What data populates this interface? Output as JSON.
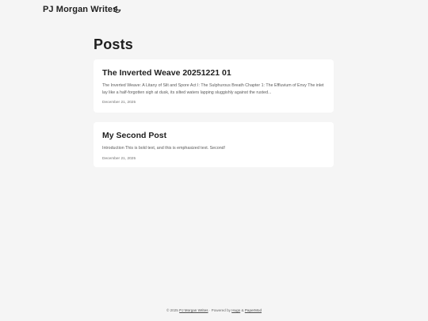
{
  "header": {
    "logo": "PJ Morgan Writes",
    "theme_toggle_icon": "moon-icon"
  },
  "main": {
    "title": "Posts",
    "posts": [
      {
        "title": "The Inverted Weave 20251221 01",
        "summary": "The Inverted Weave: A Litany of Silt and Spore Act I: The Sulphurous Breath Chapter 1: The Effluvium of Envy The inlet lay like a half-forgotten sigh at dusk, its silted waters lapping sluggishly against the rusted...",
        "date": "December 21, 2025"
      },
      {
        "title": "My Second Post",
        "summary": "Introduction This is bold text, and this is emphasized text. Second!",
        "date": "December 21, 2025"
      }
    ]
  },
  "footer": {
    "copyright": "© 2025",
    "site_link": "PJ Morgan Writes",
    "separator": "·",
    "powered_by": "Powered by",
    "hugo_link": "Hugo",
    "ampersand": "&",
    "theme_link": "PaperMod"
  },
  "colors": {
    "background": "#f5f5f5",
    "card": "#ffffff",
    "text": "#1f1f1f",
    "muted": "#707070"
  }
}
